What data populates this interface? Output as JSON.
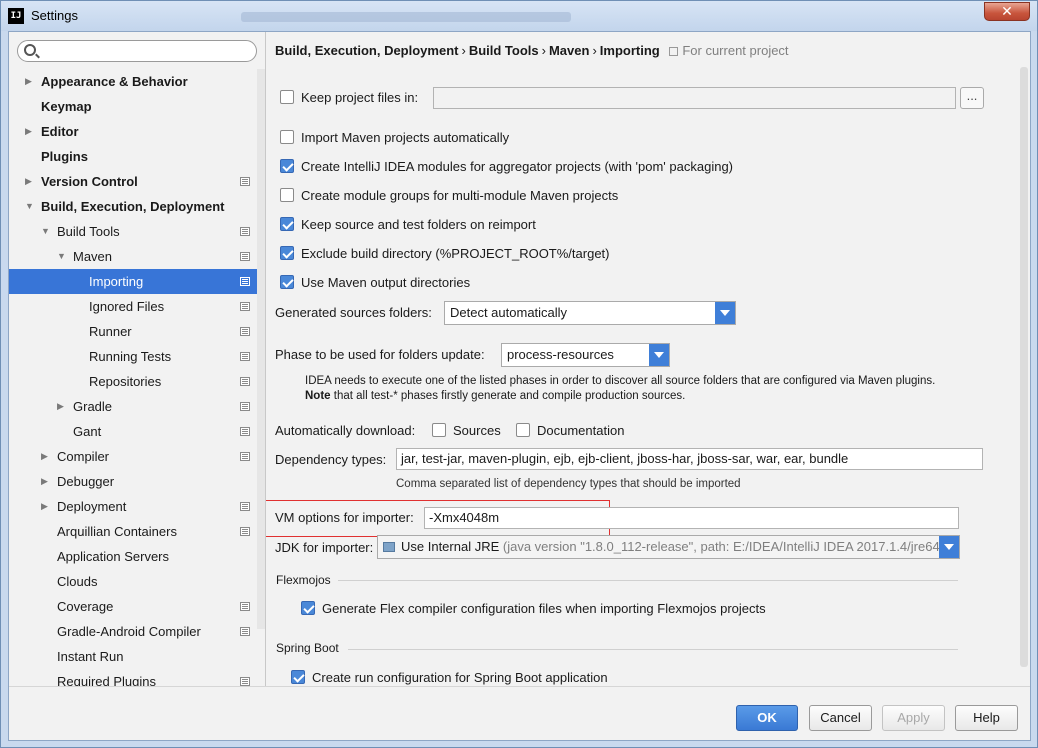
{
  "window": {
    "title": "Settings",
    "close_glyph": "✕",
    "logo_text": "IJ"
  },
  "search": {
    "placeholder": "",
    "value": ""
  },
  "sidebar": {
    "items": [
      {
        "label": "Appearance & Behavior",
        "bold": true,
        "arrow": "right",
        "indent": 0,
        "icon": false
      },
      {
        "label": "Keymap",
        "bold": true,
        "arrow": "none",
        "indent": 0,
        "icon": false
      },
      {
        "label": "Editor",
        "bold": true,
        "arrow": "right",
        "indent": 0,
        "icon": false
      },
      {
        "label": "Plugins",
        "bold": true,
        "arrow": "none",
        "indent": 0,
        "icon": false
      },
      {
        "label": "Version Control",
        "bold": true,
        "arrow": "right",
        "indent": 0,
        "icon": true
      },
      {
        "label": "Build, Execution, Deployment",
        "bold": true,
        "arrow": "down",
        "indent": 0,
        "icon": false
      },
      {
        "label": "Build Tools",
        "bold": false,
        "arrow": "down",
        "indent": 1,
        "icon": true
      },
      {
        "label": "Maven",
        "bold": false,
        "arrow": "down",
        "indent": 2,
        "icon": true
      },
      {
        "label": "Importing",
        "bold": false,
        "arrow": "none",
        "indent": 3,
        "icon": true,
        "selected": true
      },
      {
        "label": "Ignored Files",
        "bold": false,
        "arrow": "none",
        "indent": 3,
        "icon": true
      },
      {
        "label": "Runner",
        "bold": false,
        "arrow": "none",
        "indent": 3,
        "icon": true
      },
      {
        "label": "Running Tests",
        "bold": false,
        "arrow": "none",
        "indent": 3,
        "icon": true
      },
      {
        "label": "Repositories",
        "bold": false,
        "arrow": "none",
        "indent": 3,
        "icon": true
      },
      {
        "label": "Gradle",
        "bold": false,
        "arrow": "right",
        "indent": 2,
        "icon": true
      },
      {
        "label": "Gant",
        "bold": false,
        "arrow": "none",
        "indent": 2,
        "icon": true
      },
      {
        "label": "Compiler",
        "bold": false,
        "arrow": "right",
        "indent": 1,
        "icon": true
      },
      {
        "label": "Debugger",
        "bold": false,
        "arrow": "right",
        "indent": 1,
        "icon": false
      },
      {
        "label": "Deployment",
        "bold": false,
        "arrow": "right",
        "indent": 1,
        "icon": true
      },
      {
        "label": "Arquillian Containers",
        "bold": false,
        "arrow": "none",
        "indent": 1,
        "icon": true
      },
      {
        "label": "Application Servers",
        "bold": false,
        "arrow": "none",
        "indent": 1,
        "icon": false
      },
      {
        "label": "Clouds",
        "bold": false,
        "arrow": "none",
        "indent": 1,
        "icon": false
      },
      {
        "label": "Coverage",
        "bold": false,
        "arrow": "none",
        "indent": 1,
        "icon": true
      },
      {
        "label": "Gradle-Android Compiler",
        "bold": false,
        "arrow": "none",
        "indent": 1,
        "icon": true
      },
      {
        "label": "Instant Run",
        "bold": false,
        "arrow": "none",
        "indent": 1,
        "icon": false
      },
      {
        "label": "Required Plugins",
        "bold": false,
        "arrow": "none",
        "indent": 1,
        "icon": true
      }
    ]
  },
  "breadcrumb": {
    "parts": [
      "Build, Execution, Deployment",
      "Build Tools",
      "Maven",
      "Importing"
    ],
    "separator": "›",
    "scope": "For current project"
  },
  "importing": {
    "keep_project_files": {
      "label": "Keep project files in:",
      "checked": false,
      "value": ""
    },
    "browse_label": "...",
    "checkboxes": [
      {
        "label": "Import Maven projects automatically",
        "checked": false
      },
      {
        "label": "Create IntelliJ IDEA modules for aggregator projects (with 'pom' packaging)",
        "checked": true
      },
      {
        "label": "Create module groups for multi-module Maven projects",
        "checked": false
      },
      {
        "label": "Keep source and test folders on reimport",
        "checked": true
      },
      {
        "label": "Exclude build directory (%PROJECT_ROOT%/target)",
        "checked": true
      },
      {
        "label": "Use Maven output directories",
        "checked": true
      }
    ],
    "generated_sources": {
      "label": "Generated sources folders:",
      "value": "Detect automatically"
    },
    "phase": {
      "label": "Phase to be used for folders update:",
      "value": "process-resources",
      "note_line1": "IDEA needs to execute one of the listed phases in order to discover all source folders that are configured via Maven plugins.",
      "note_bold": "Note",
      "note_line2": " that all test-* phases firstly generate and compile production sources."
    },
    "auto_download": {
      "label": "Automatically download:",
      "sources": {
        "label": "Sources",
        "checked": false
      },
      "documentation": {
        "label": "Documentation",
        "checked": false
      }
    },
    "dependency_types": {
      "label": "Dependency types:",
      "value": "jar, test-jar, maven-plugin, ejb, ejb-client, jboss-har, jboss-sar, war, ear, bundle",
      "hint": "Comma separated list of dependency types that should be imported"
    },
    "vm_options": {
      "label": "VM options for importer:",
      "value": "-Xmx4048m"
    },
    "jdk": {
      "label": "JDK for importer:",
      "value": "Use Internal JRE",
      "detail": "(java version \"1.8.0_112-release\", path: E:/IDEA/IntelliJ IDEA 2017.1.4/jre64)"
    },
    "flexmojos": {
      "title": "Flexmojos",
      "checkbox": {
        "label": "Generate Flex compiler configuration files when importing Flexmojos projects",
        "checked": true
      }
    },
    "spring_boot": {
      "title": "Spring Boot",
      "checkbox": {
        "label": "Create run configuration for Spring Boot application",
        "checked": true
      }
    }
  },
  "footer": {
    "ok": "OK",
    "cancel": "Cancel",
    "apply": "Apply",
    "help": "Help"
  },
  "colors": {
    "selection": "#3875d7",
    "accent": "#3f7fd8",
    "highlight_box": "#e03030"
  }
}
